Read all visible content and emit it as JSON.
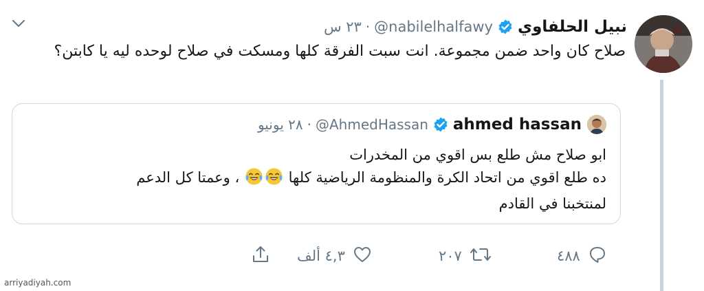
{
  "tweet": {
    "author_name": "نبيل الحلفاوي",
    "handle": "@nabilelhalfawy",
    "separator": "·",
    "time": "٢٣ س",
    "text": "صلاح كان واحد ضمن مجموعة. انت سبت الفرقة كلها ومسكت في صلاح لوحده ليه يا كابتن؟"
  },
  "quoted_tweet": {
    "author_name": "ahmed hassan",
    "handle": "@AhmedHassan",
    "separator": "·",
    "time": "٢٨ يونيو",
    "line1": "ابو صلاح مش طلع بس اقوي من المخدرات",
    "line2_start": "ده طلع اقوي من اتحاد الكرة والمنظومة الرياضية كلها",
    "line2_end": "، وعمتا كل الدعم",
    "line3": "لمنتخبنا في القادم"
  },
  "actions": {
    "replies": "٤٨٨",
    "retweets": "٢٠٧",
    "likes": "٤,٣ ألف"
  },
  "icons": {
    "verified": "verified-badge-icon",
    "reply": "reply-icon",
    "retweet": "retweet-icon",
    "like": "heart-icon",
    "share": "share-icon",
    "more": "chevron-down-icon",
    "emoji": "tears-of-joy-emoji"
  },
  "colors": {
    "verified": "#1da1f2",
    "secondary_text": "#657786",
    "border": "#ccd6dd"
  },
  "watermark": "arriyadiyah.com"
}
